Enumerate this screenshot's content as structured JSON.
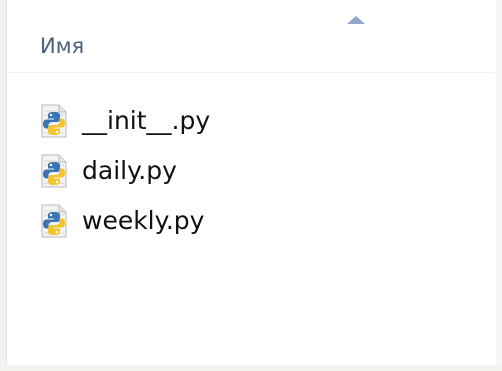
{
  "header": {
    "column_name": "Имя",
    "sort_direction": "ascending"
  },
  "files": [
    {
      "name": "__init__.py",
      "icon": "python-file-icon"
    },
    {
      "name": "daily.py",
      "icon": "python-file-icon"
    },
    {
      "name": "weekly.py",
      "icon": "python-file-icon"
    }
  ],
  "colors": {
    "header_text": "#4c607a",
    "sort_arrow": "#8fa7c7",
    "python_blue": "#3a74b4",
    "python_yellow": "#f2c530"
  }
}
